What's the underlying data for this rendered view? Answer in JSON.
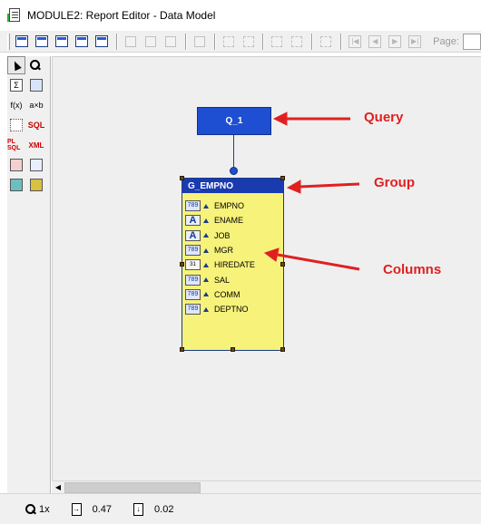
{
  "window": {
    "title": "MODULE2: Report Editor - Data Model",
    "icon": "report-editor-icon"
  },
  "toolbar": {
    "page_label": "Page:",
    "page_value": ""
  },
  "palette": {
    "rows": [
      [
        "select-arrow-icon",
        "magnify-icon"
      ],
      [
        "summary-column-icon",
        "database-icon"
      ],
      [
        "formula-column-icon",
        "placeholder-column-icon"
      ],
      [
        "data-link-icon",
        "sql-query-icon"
      ],
      [
        "plsql-query-icon",
        "xml-query-icon"
      ],
      [
        "cross-product-icon",
        "ref-cursor-icon"
      ],
      [
        "object-icon",
        "package-icon"
      ]
    ],
    "labels": {
      "sum": "Σ",
      "formula": "f(x)",
      "placeholder": "a×b",
      "sql": "SQL",
      "plsql": "PL SQL",
      "xml": "XML"
    }
  },
  "canvas": {
    "query": {
      "name": "Q_1"
    },
    "group": {
      "name": "G_EMPNO",
      "columns": [
        {
          "name": "EMPNO",
          "type": "number-type-icon",
          "type_label": "789"
        },
        {
          "name": "ENAME",
          "type": "char-type-icon",
          "type_label": "A"
        },
        {
          "name": "JOB",
          "type": "char-type-icon",
          "type_label": "A"
        },
        {
          "name": "MGR",
          "type": "number-type-icon",
          "type_label": "789"
        },
        {
          "name": "HIREDATE",
          "type": "date-type-icon",
          "type_label": "31"
        },
        {
          "name": "SAL",
          "type": "number-type-icon",
          "type_label": "789"
        },
        {
          "name": "COMM",
          "type": "number-type-icon",
          "type_label": "789"
        },
        {
          "name": "DEPTNO",
          "type": "number-type-icon",
          "type_label": "789"
        }
      ]
    },
    "annotations": {
      "query": "Query",
      "group": "Group",
      "columns": "Columns"
    },
    "annotation_color": "#e02020"
  },
  "statusbar": {
    "zoom": "1x",
    "pos_x": "0.47",
    "pos_y": "0.02"
  },
  "colors": {
    "query_fill": "#1e4fd2",
    "group_header": "#1a3bb0",
    "group_body": "#f6f27a"
  }
}
